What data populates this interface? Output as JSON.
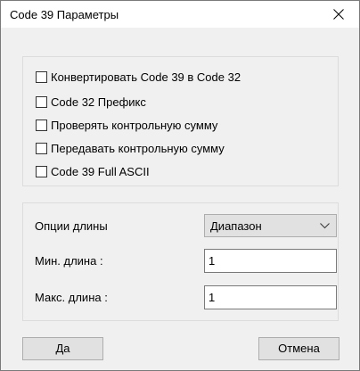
{
  "window": {
    "title": "Code 39 Параметры"
  },
  "options": {
    "checkboxes": [
      {
        "label": "Конвертировать Code 39 в Code 32",
        "checked": false
      },
      {
        "label": "Code 32 Префикс",
        "checked": false
      },
      {
        "label": "Проверять контрольную сумму",
        "checked": false
      },
      {
        "label": "Передавать контрольную сумму",
        "checked": false
      },
      {
        "label": "Code 39 Full ASCII",
        "checked": false
      }
    ]
  },
  "length": {
    "options_label": "Опции длины",
    "mode_value": "Диапазон",
    "min_label": "Мин. длина :",
    "min_value": "1",
    "max_label": "Макс. длина :",
    "max_value": "1"
  },
  "buttons": {
    "ok_label": "Да",
    "cancel_label": "Отмена"
  },
  "icons": {
    "close": "close-icon",
    "dropdown": "chevron-down-icon"
  }
}
